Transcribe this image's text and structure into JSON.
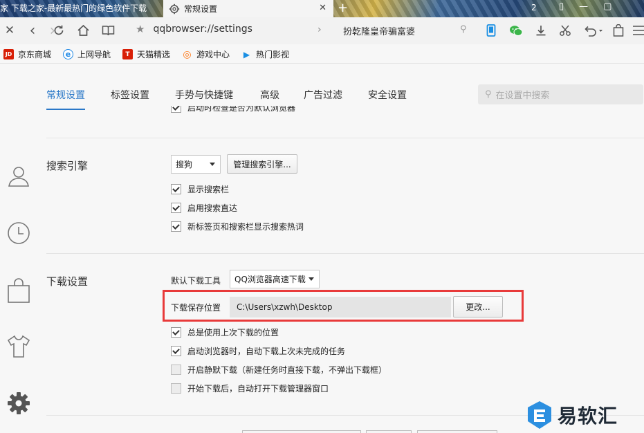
{
  "tabs": [
    {
      "label": "家 下载之家-最新最热门的绿色软件下载",
      "active": false
    },
    {
      "label": "常规设置",
      "active": true
    }
  ],
  "tab_count": "2",
  "toolbar": {
    "address": "qqbrowser://settings",
    "search_text": "扮乾隆皇帝骗富婆"
  },
  "bookmarks": [
    {
      "label": "京东商城",
      "icon": "jd-icon",
      "color": "#d81e06",
      "glyph": "JD"
    },
    {
      "label": "上网导航",
      "icon": "ie-icon",
      "color": "#1e88e5",
      "glyph": "e"
    },
    {
      "label": "天猫精选",
      "icon": "tmall-icon",
      "color": "#d81e06",
      "glyph": "T"
    },
    {
      "label": "游戏中心",
      "icon": "gamepad-icon",
      "color": "#ff7a1a",
      "glyph": "◎"
    },
    {
      "label": "热门影视",
      "icon": "play-icon",
      "color": "#1a8fe3",
      "glyph": "▶"
    }
  ],
  "settings": {
    "nav_tabs": [
      "常规设置",
      "标签设置",
      "手势与快捷键",
      "高级",
      "广告过滤",
      "安全设置"
    ],
    "active_tab": "常规设置",
    "search_placeholder": "在设置中搜索",
    "cut_off_option": "启动时检查是否为默认浏览器",
    "search_engine": {
      "title": "搜索引擎",
      "selected": "搜狗",
      "manage_button": "管理搜索引擎...",
      "options": [
        {
          "label": "显示搜索栏",
          "checked": true
        },
        {
          "label": "启用搜索直达",
          "checked": true
        },
        {
          "label": "新标签页和搜索栏显示搜索热词",
          "checked": true
        }
      ]
    },
    "download": {
      "title": "下载设置",
      "tool_label": "默认下载工具",
      "tool_selected": "QQ浏览器高速下载",
      "save_label": "下载保存位置",
      "save_path": "C:\\Users\\xzwh\\Desktop",
      "change_button": "更改...",
      "options": [
        {
          "label": "总是使用上次下载的位置",
          "checked": true
        },
        {
          "label": "启动浏览器时，自动下载上次未完成的任务",
          "checked": true
        },
        {
          "label": "开启静默下载（新建任务时直接下载，不弹出下载框）",
          "checked": false
        },
        {
          "label": "开始下载后，自动打开下载管理器窗口",
          "checked": false
        }
      ]
    }
  },
  "watermark": {
    "text": "易软汇"
  },
  "colors": {
    "accent": "#2a78c8",
    "highlight": "#e83a3a"
  }
}
